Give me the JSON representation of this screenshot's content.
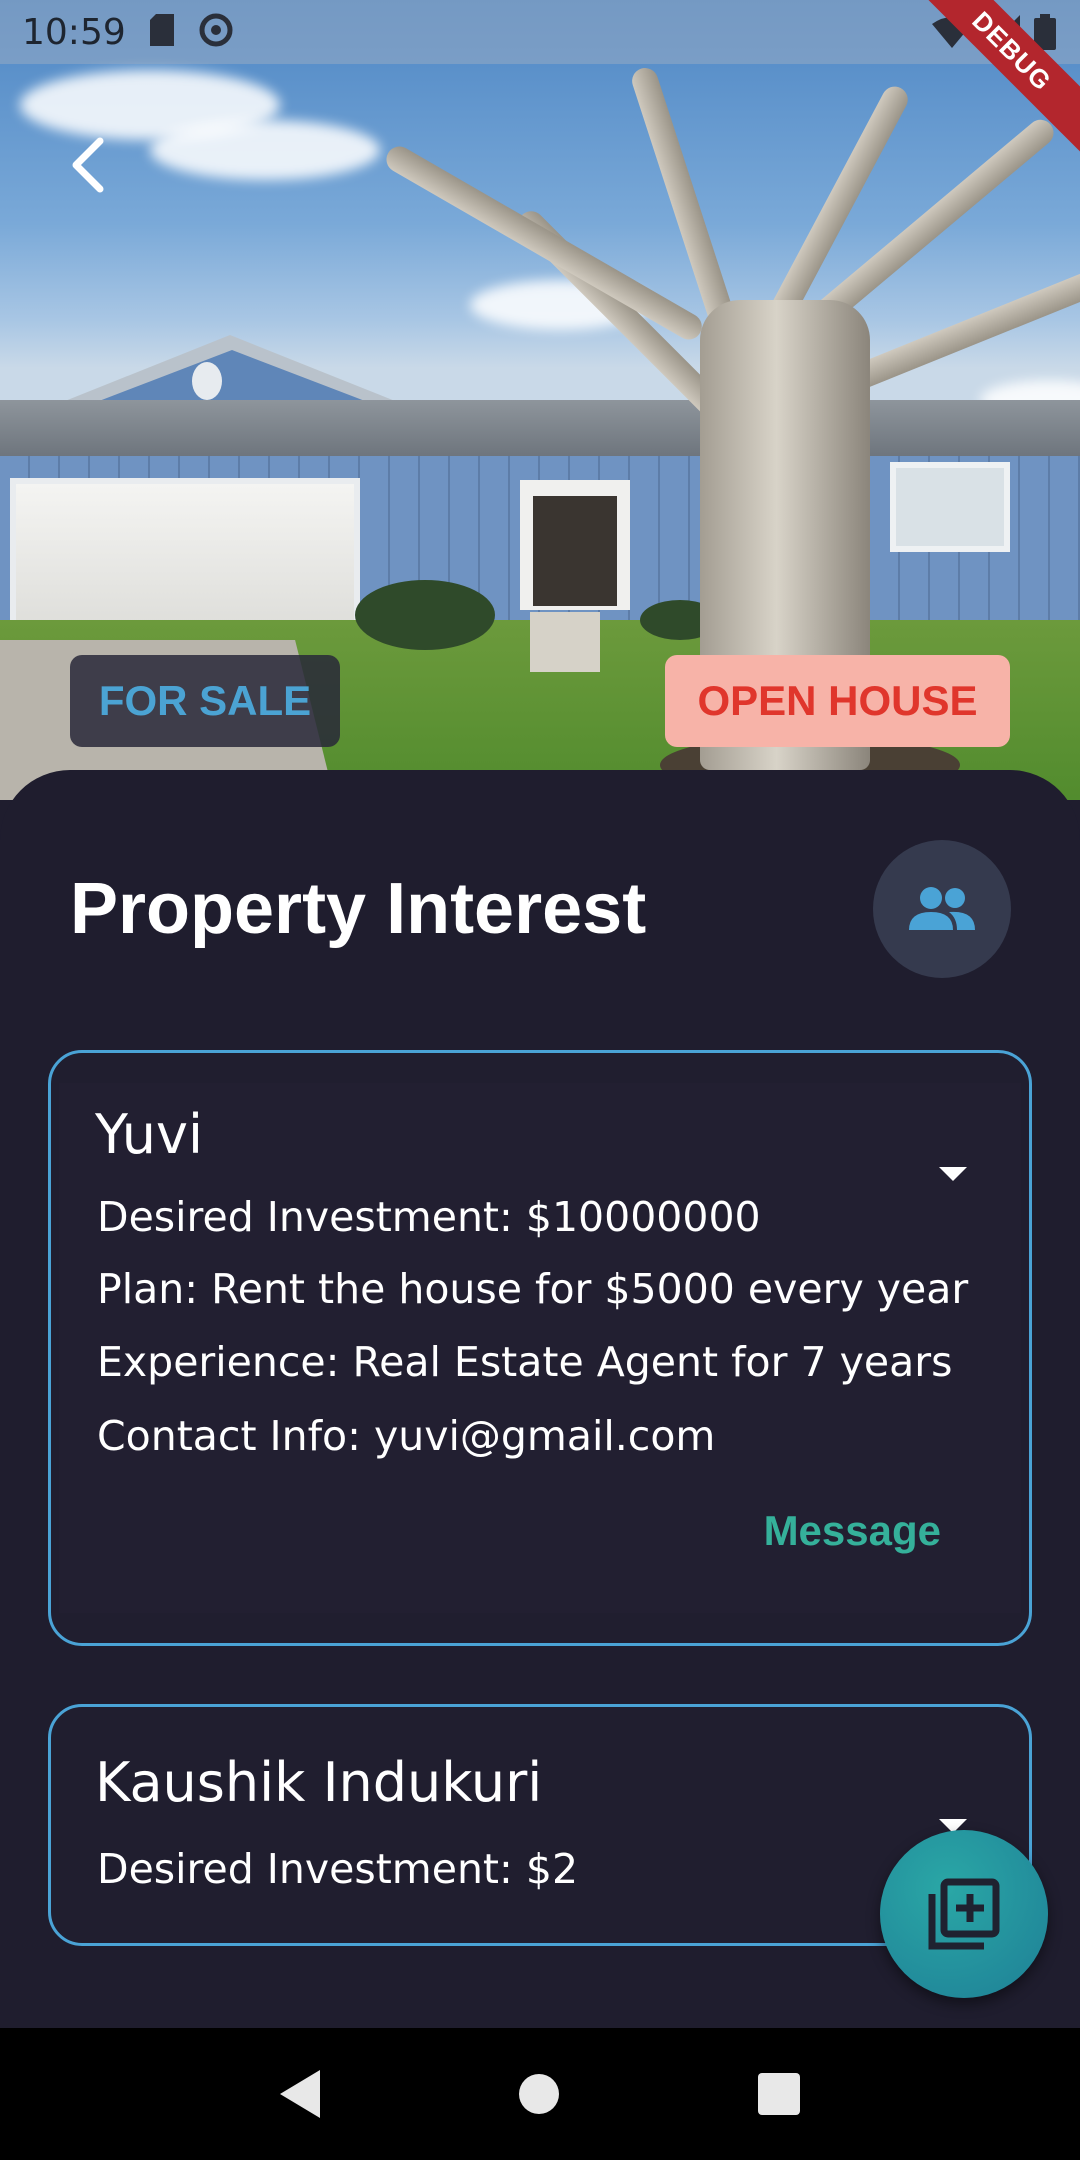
{
  "status_bar": {
    "time": "10:59",
    "debug_banner": "DEBUG"
  },
  "badges": {
    "for_sale": "FOR SALE",
    "open_house": "OPEN HOUSE"
  },
  "header": {
    "title": "Property Interest"
  },
  "interests": [
    {
      "name": "Yuvi",
      "desired_investment": "Desired Investment:  $10000000",
      "plan": "Plan: Rent the house for $5000 every year",
      "experience": "Experience: Real Estate Agent for 7 years",
      "contact": "Contact Info: yuvi@gmail.com",
      "action_label": "Message",
      "expanded": true
    },
    {
      "name": "Kaushik Indukuri",
      "desired_investment": "Desired Investment:  $2",
      "expanded": false
    }
  ],
  "colors": {
    "background": "#1f1d2e",
    "card_border": "#4aa3d6",
    "accent_teal": "#35b09a",
    "for_sale_text": "#4ba3d3",
    "open_house_bg": "#f7b3a8",
    "open_house_text": "#e0362c"
  },
  "icons": {
    "back": "arrow-back-icon",
    "people": "people-icon",
    "expand": "arrow-drop-down-icon",
    "add": "library-add-icon"
  }
}
